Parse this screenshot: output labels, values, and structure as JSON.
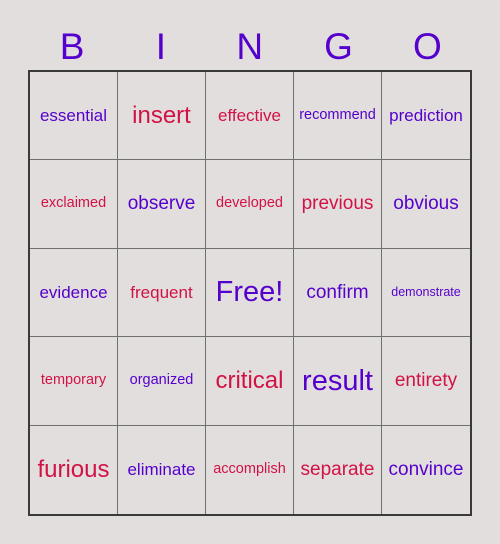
{
  "header": {
    "letters": [
      "B",
      "I",
      "N",
      "G",
      "O"
    ]
  },
  "colors": {
    "purple": "#5500cc",
    "red": "#d21245",
    "background": "#e2dedd",
    "border": "#3a3a3a",
    "gridline": "#6f6f6f"
  },
  "grid": {
    "rows": [
      [
        {
          "label": "essential",
          "color": "purple",
          "size": "md"
        },
        {
          "label": "insert",
          "color": "red",
          "size": "xl"
        },
        {
          "label": "effective",
          "color": "red",
          "size": "md"
        },
        {
          "label": "recommend",
          "color": "purple",
          "size": "sm"
        },
        {
          "label": "prediction",
          "color": "purple",
          "size": "md"
        }
      ],
      [
        {
          "label": "exclaimed",
          "color": "red",
          "size": "sm"
        },
        {
          "label": "observe",
          "color": "purple",
          "size": "lg"
        },
        {
          "label": "developed",
          "color": "red",
          "size": "sm"
        },
        {
          "label": "previous",
          "color": "red",
          "size": "lg"
        },
        {
          "label": "obvious",
          "color": "purple",
          "size": "lg"
        }
      ],
      [
        {
          "label": "evidence",
          "color": "purple",
          "size": "md"
        },
        {
          "label": "frequent",
          "color": "red",
          "size": "md"
        },
        {
          "label": "Free!",
          "color": "purple",
          "size": "xxl"
        },
        {
          "label": "confirm",
          "color": "purple",
          "size": "lg"
        },
        {
          "label": "demonstrate",
          "color": "purple",
          "size": "xs"
        }
      ],
      [
        {
          "label": "temporary",
          "color": "red",
          "size": "sm"
        },
        {
          "label": "organized",
          "color": "purple",
          "size": "sm"
        },
        {
          "label": "critical",
          "color": "red",
          "size": "xl"
        },
        {
          "label": "result",
          "color": "purple",
          "size": "xxl"
        },
        {
          "label": "entirety",
          "color": "red",
          "size": "lg"
        }
      ],
      [
        {
          "label": "furious",
          "color": "red",
          "size": "xl"
        },
        {
          "label": "eliminate",
          "color": "purple",
          "size": "md"
        },
        {
          "label": "accomplish",
          "color": "red",
          "size": "sm"
        },
        {
          "label": "separate",
          "color": "red",
          "size": "lg"
        },
        {
          "label": "convince",
          "color": "purple",
          "size": "lg"
        }
      ]
    ]
  }
}
